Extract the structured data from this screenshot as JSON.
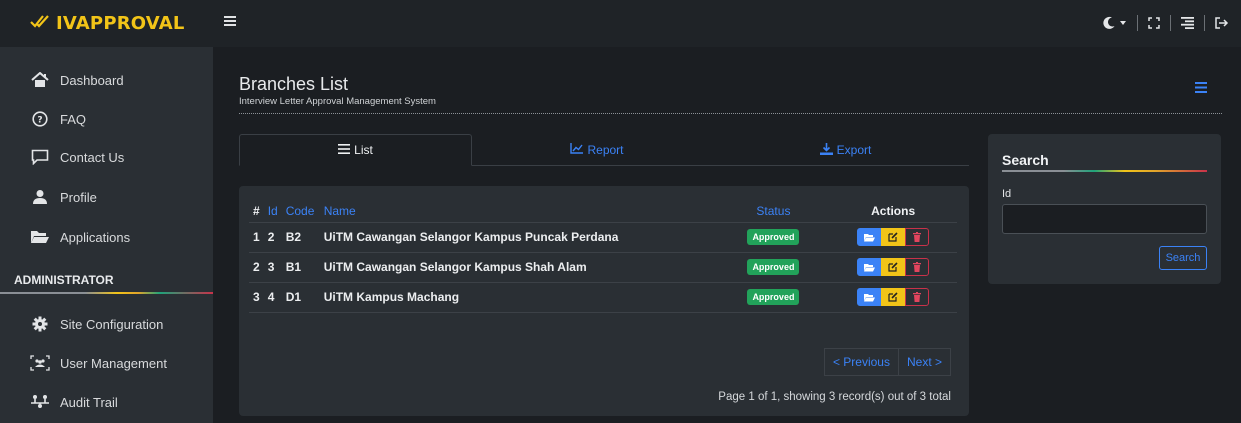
{
  "brand": {
    "name": "IVAPPROVAL",
    "icon": "check-double-icon",
    "color": "#f2c418"
  },
  "sidebar": {
    "items": [
      {
        "label": "Dashboard",
        "icon": "home-icon"
      },
      {
        "label": "FAQ",
        "icon": "question-circle-icon"
      },
      {
        "label": "Contact Us",
        "icon": "message-square-icon"
      },
      {
        "label": "Profile",
        "icon": "user-icon"
      },
      {
        "label": "Applications",
        "icon": "folder-open-icon"
      }
    ],
    "admin_heading": "ADMINISTRATOR",
    "admin_items": [
      {
        "label": "Site Configuration",
        "icon": "cog-icon"
      },
      {
        "label": "User Management",
        "icon": "users-icon"
      },
      {
        "label": "Audit Trail",
        "icon": "sitemap-icon"
      }
    ]
  },
  "page": {
    "title": "Branches List",
    "subtitle": "Interview Letter Approval Management System"
  },
  "tabs": [
    {
      "label": "List",
      "icon": "list-icon",
      "active": true
    },
    {
      "label": "Report",
      "icon": "chart-line-icon",
      "active": false
    },
    {
      "label": "Export",
      "icon": "download-icon",
      "active": false
    }
  ],
  "table": {
    "headers": {
      "num": "#",
      "id": "Id",
      "code": "Code",
      "name": "Name",
      "status": "Status",
      "actions": "Actions"
    },
    "rows": [
      {
        "num": "1",
        "id": "2",
        "code": "B2",
        "name": "UiTM Cawangan Selangor Kampus Puncak Perdana",
        "status": "Approved"
      },
      {
        "num": "2",
        "id": "3",
        "code": "B1",
        "name": "UiTM Cawangan Selangor Kampus Shah Alam",
        "status": "Approved"
      },
      {
        "num": "3",
        "id": "4",
        "code": "D1",
        "name": "UiTM Kampus Machang",
        "status": "Approved"
      }
    ]
  },
  "pager": {
    "previous": "< Previous",
    "next": "Next >",
    "info": "Page 1 of 1, showing 3 record(s) out of 3 total"
  },
  "search": {
    "title": "Search",
    "id_label": "Id",
    "id_value": "",
    "button": "Search"
  },
  "colors": {
    "accent": "#3b82f6",
    "approved": "#22a25a",
    "danger": "#c8324a"
  }
}
